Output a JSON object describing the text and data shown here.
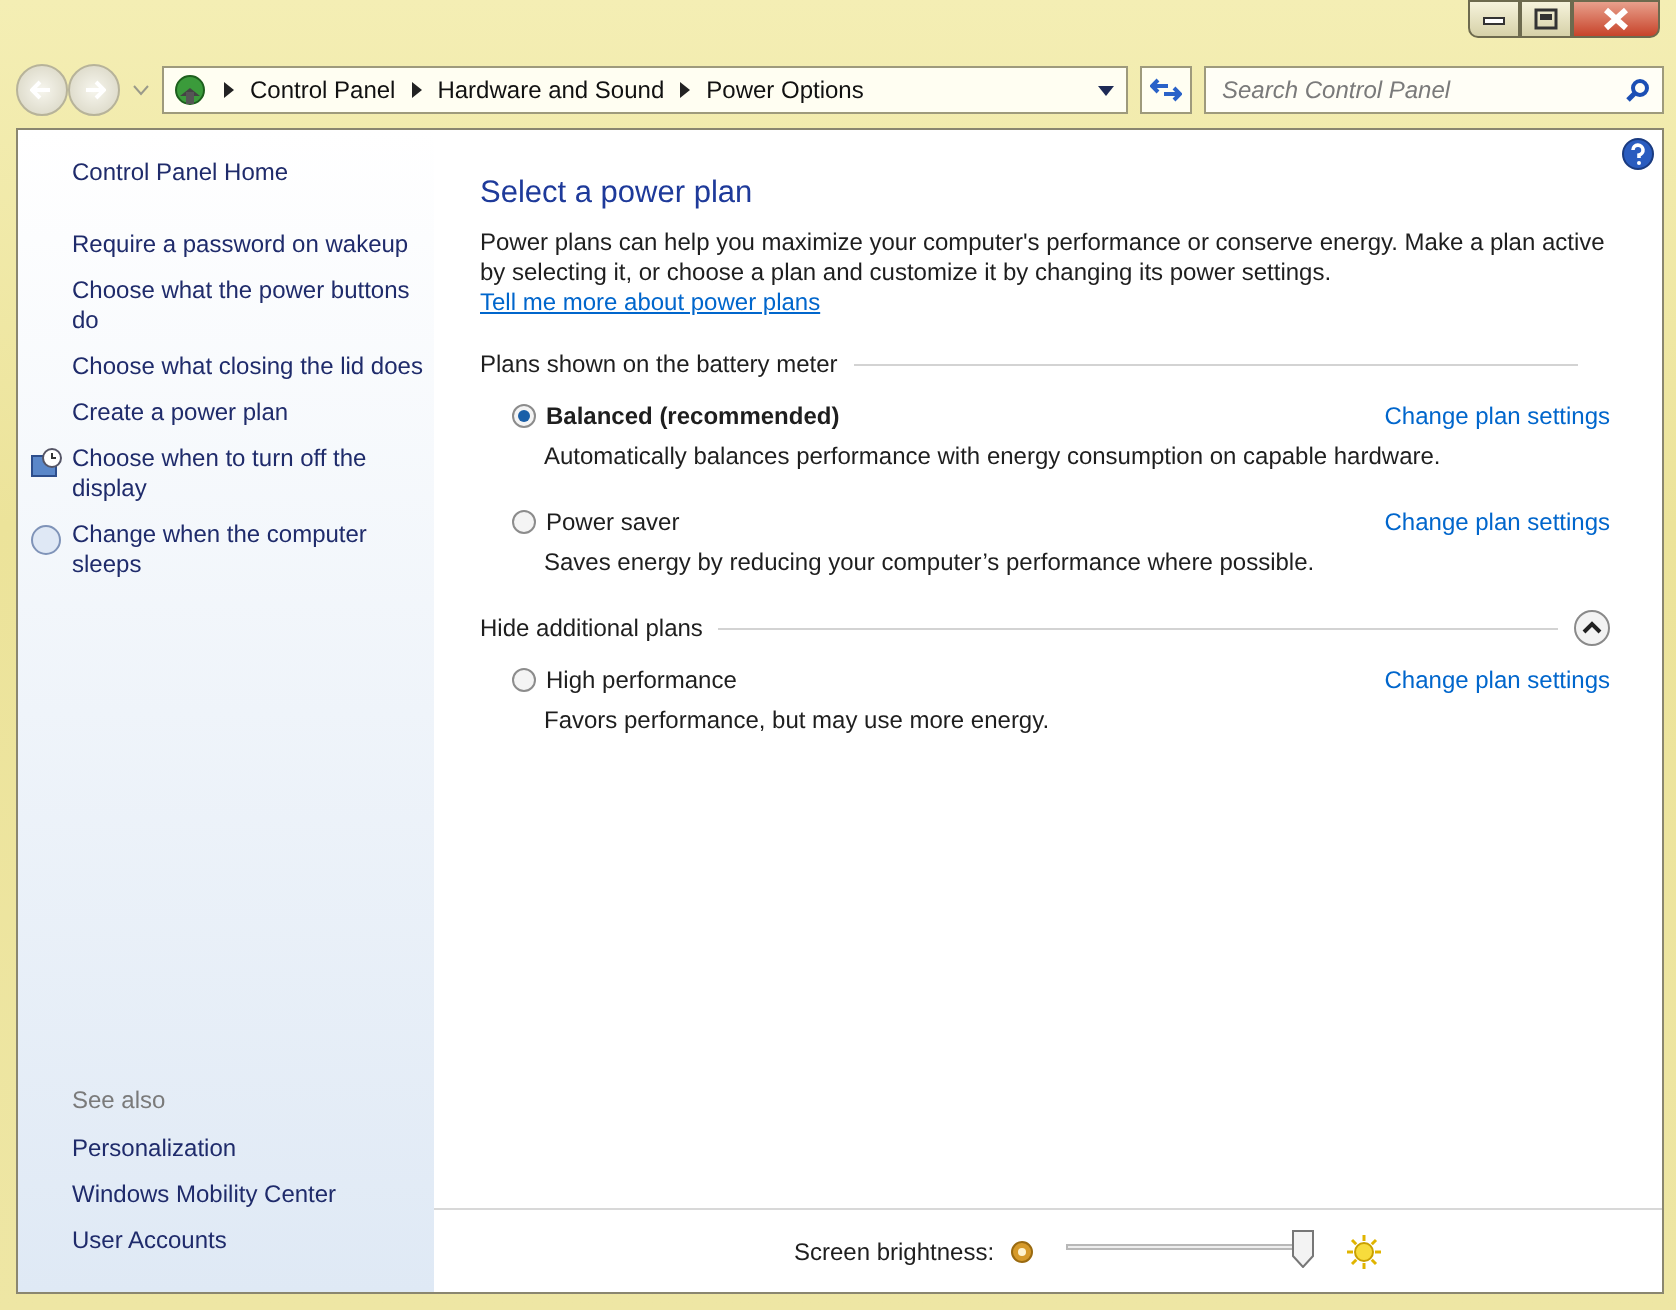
{
  "window": {
    "controls": [
      {
        "kind": "minimize"
      },
      {
        "kind": "maximize"
      },
      {
        "kind": "close"
      }
    ]
  },
  "address_bar": {
    "breadcrumbs": [
      "Control Panel",
      "Hardware and Sound",
      "Power Options"
    ],
    "search": {
      "placeholder": "Search Control Panel"
    }
  },
  "sidebar": {
    "items": [
      {
        "label": "Control Panel Home",
        "kind": "home"
      },
      {
        "label": "Require a password on wakeup",
        "kind": "plain"
      },
      {
        "label": "Choose what the power buttons do",
        "kind": "plain"
      },
      {
        "label": "Choose what closing the lid does",
        "kind": "plain"
      },
      {
        "label": "Create a power plan",
        "kind": "plain"
      },
      {
        "label": "Choose when to turn off the display",
        "kind": "display"
      },
      {
        "label": "Change when the computer sleeps",
        "kind": "sleep"
      }
    ],
    "see_also": {
      "heading": "See also",
      "links": [
        "Personalization",
        "Windows Mobility Center",
        "User Accounts"
      ]
    }
  },
  "main": {
    "title": "Select a power plan",
    "intro": "Power plans can help you maximize your computer's performance or conserve energy. Make a plan active by selecting it, or choose a plan and customize it by changing its power settings.",
    "intro_link": "Tell me more about power plans",
    "groups": [
      {
        "heading": "Plans shown on the battery meter",
        "plans": [
          {
            "name": "Balanced (recommended)",
            "selected": true,
            "description": "Automatically balances performance with energy consumption on capable hardware.",
            "link": "Change plan settings"
          },
          {
            "name": "Power saver",
            "selected": false,
            "description": "Saves energy by reducing your computer’s performance where possible.",
            "link": "Change plan settings"
          }
        ]
      },
      {
        "heading": "Hide additional plans",
        "expanded": true,
        "plans": [
          {
            "name": "High performance",
            "selected": false,
            "description": "Favors performance, but may use more energy.",
            "link": "Change plan settings"
          }
        ]
      }
    ]
  },
  "brightness": {
    "label": "Screen brightness:",
    "level": 1.0
  }
}
